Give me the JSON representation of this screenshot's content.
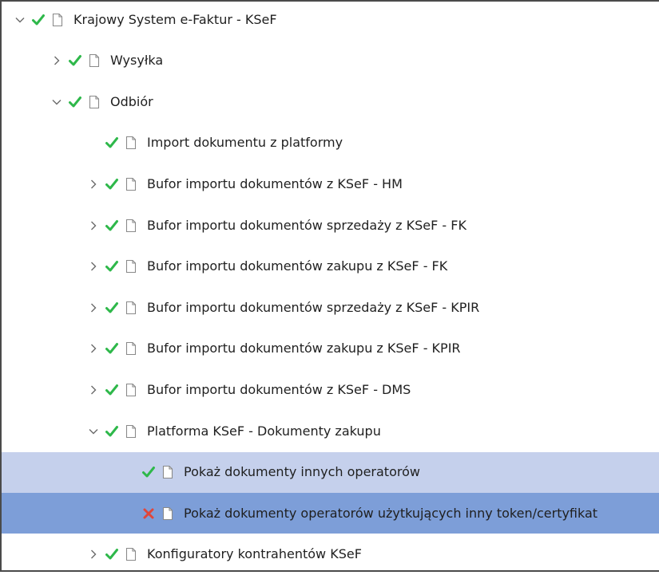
{
  "tree": {
    "items": [
      {
        "label": "Krajowy System e-Faktur - KSeF",
        "expander": "expanded",
        "status": "check-icon",
        "level": 0
      },
      {
        "label": "Wysyłka",
        "expander": "collapsed",
        "status": "check-icon",
        "level": 1
      },
      {
        "label": "Odbiór",
        "expander": "expanded",
        "status": "check-icon",
        "level": 1
      },
      {
        "label": "Import dokumentu z platformy",
        "expander": "none",
        "status": "check-icon",
        "level": 2
      },
      {
        "label": "Bufor importu dokumentów z KSeF - HM",
        "expander": "collapsed",
        "status": "check-icon",
        "level": 2
      },
      {
        "label": "Bufor importu dokumentów sprzedaży z KSeF - FK",
        "expander": "collapsed",
        "status": "check-icon",
        "level": 2
      },
      {
        "label": "Bufor importu dokumentów zakupu z KSeF - FK",
        "expander": "collapsed",
        "status": "check-icon",
        "level": 2
      },
      {
        "label": "Bufor importu dokumentów sprzedaży z KSeF - KPIR",
        "expander": "collapsed",
        "status": "check-icon",
        "level": 2
      },
      {
        "label": "Bufor importu dokumentów zakupu z KSeF - KPIR",
        "expander": "collapsed",
        "status": "check-icon",
        "level": 2
      },
      {
        "label": "Bufor importu dokumentów z KSeF - DMS",
        "expander": "collapsed",
        "status": "check-icon",
        "level": 2
      },
      {
        "label": "Platforma KSeF - Dokumenty zakupu",
        "expander": "expanded",
        "status": "check-icon",
        "level": 2
      },
      {
        "label": "Pokaż dokumenty innych operatorów",
        "expander": "none",
        "status": "check-icon",
        "level": 3,
        "selection": "hover"
      },
      {
        "label": "Pokaż dokumenty operatorów użytkujących inny token/certyfikat",
        "expander": "none",
        "status": "cross-icon",
        "level": 3,
        "selection": "selected"
      },
      {
        "label": "Konfiguratory kontrahentów KSeF",
        "expander": "collapsed",
        "status": "check-icon",
        "level": 2
      }
    ]
  },
  "colors": {
    "check": "#2eb84a",
    "cross": "#e0463a",
    "chevron": "#6a6a6a",
    "doc_outline": "#8a8a8a",
    "hover_bg": "#c5d0ec",
    "selected_bg": "#7d9ed8",
    "text": "#1f1f1f"
  }
}
